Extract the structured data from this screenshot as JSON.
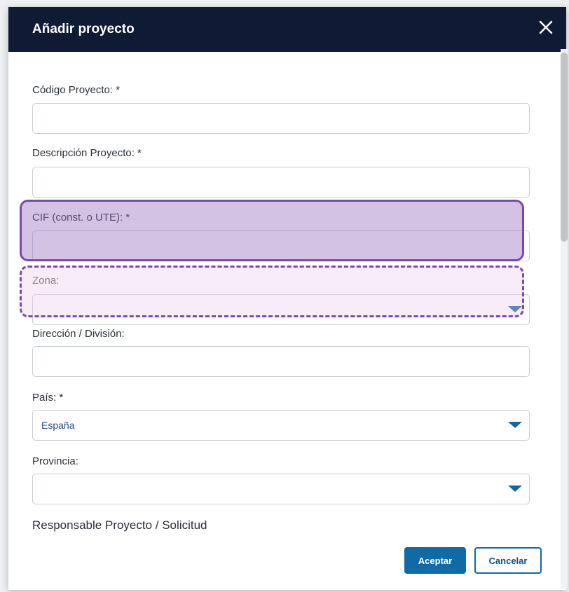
{
  "dialog": {
    "title": "Añadir proyecto",
    "close_icon": "close-icon"
  },
  "form": {
    "codigo_proyecto": {
      "label": "Código Proyecto: *",
      "value": ""
    },
    "descripcion_proyecto": {
      "label": "Descripción Proyecto: *",
      "value": ""
    },
    "cif": {
      "label": "CIF (const. o UTE): *",
      "value": ""
    },
    "zona": {
      "label": "Zona:",
      "value": ""
    },
    "direccion_division": {
      "label": "Dirección / División:",
      "value": ""
    },
    "pais": {
      "label": "País: *",
      "value": "España"
    },
    "provincia": {
      "label": "Provincia:",
      "value": ""
    },
    "responsable_section": "Responsable Proyecto / Solicitud"
  },
  "actions": {
    "accept": "Aceptar",
    "cancel": "Cancelar"
  },
  "colors": {
    "header_bg": "#0f1a35",
    "primary": "#0f6aa6",
    "highlight_border": "#7b4aa8"
  }
}
